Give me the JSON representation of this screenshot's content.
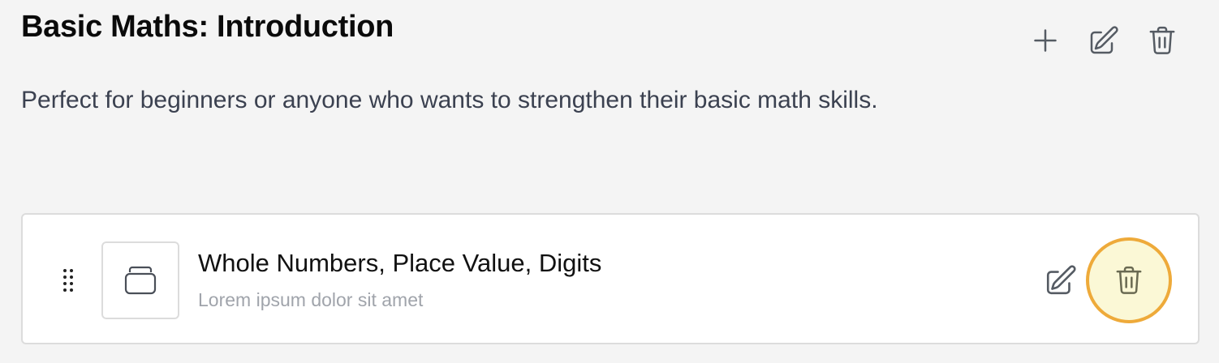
{
  "header": {
    "title": "Basic Maths: Introduction",
    "actions": {
      "add_icon": "plus-icon",
      "edit_icon": "pencil-square-icon",
      "delete_icon": "trash-icon"
    }
  },
  "description": "Perfect for beginners or anyone who wants to strengthen their basic math skills.",
  "lessons": [
    {
      "title": "Whole Numbers, Place Value, Digits",
      "subtitle": "Lorem ipsum dolor sit amet",
      "thumbnail_icon": "stack-icon",
      "drag_icon": "drag-handle-icon",
      "edit_icon": "pencil-square-icon",
      "delete_icon": "trash-icon"
    }
  ],
  "colors": {
    "background": "#f4f4f4",
    "highlight_ring": "#eeaa3a",
    "highlight_fill": "#fbf8d6"
  }
}
